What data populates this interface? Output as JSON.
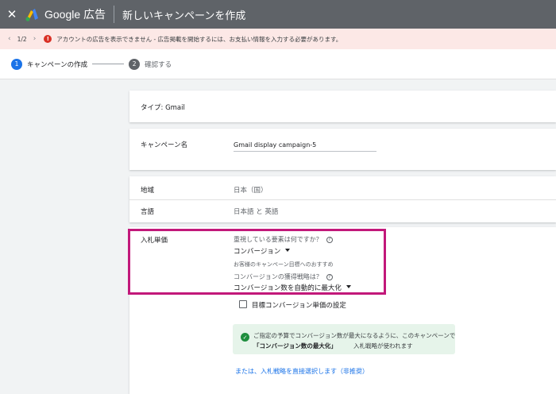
{
  "topbar": {
    "close_icon": "close-icon",
    "brand": "Google 広告",
    "title": "新しいキャンペーンを作成"
  },
  "alert": {
    "pager": "1/2",
    "message": "アカウントの広告を表示できません - 広告掲載を開始するには、お支払い情報を入力する必要があります。"
  },
  "steps": [
    {
      "num": "1",
      "label": "キャンペーンの作成"
    },
    {
      "num": "2",
      "label": "確認する"
    }
  ],
  "type_card": {
    "text": "タイプ: Gmail"
  },
  "name_card": {
    "label": "キャンペーン名",
    "value": "Gmail display campaign-5"
  },
  "region_card": {
    "region_label": "地域",
    "region_value": "日本（国）",
    "lang_label": "言語",
    "lang_value": "日本語 と 英語"
  },
  "bid_card": {
    "label": "入札単価",
    "focus_question": "重視している要素は何ですか？",
    "focus_value": "コンバージョン",
    "recommend_note": "お客様のキャンペーン目標へのおすすめ",
    "strategy_question": "コンバージョンの獲得戦略は？",
    "strategy_value": "コンバージョン数を自動的に最大化",
    "target_cpa_label": "目標コンバージョン単価の設定",
    "info_line1": "ご指定の予算でコンバージョン数が最大になるように、このキャンペーンで",
    "info_bold": "「コンバージョン数の最大化」",
    "info_line2": "入札戦略が使われます",
    "manual_link": "または、入札戦略を直接選択します（非推奨）"
  },
  "colors": {
    "accent": "#1a73e8",
    "highlight": "#c2187a",
    "alert_bg": "#fce8e6",
    "success": "#1e8e3e"
  }
}
